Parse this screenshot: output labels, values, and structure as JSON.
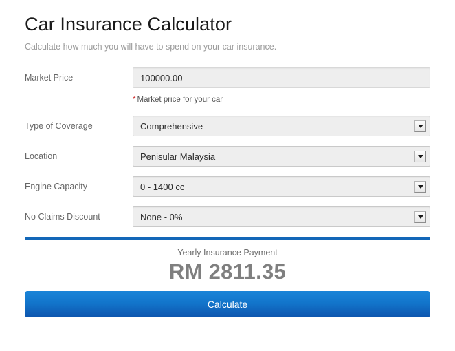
{
  "header": {
    "title": "Car Insurance Calculator",
    "subtitle": "Calculate how much you will have to spend on your car insurance."
  },
  "form": {
    "market_price": {
      "label": "Market Price",
      "value": "100000.00",
      "placeholder": "",
      "help_star": "*",
      "help_text": "Market price for your car"
    },
    "coverage": {
      "label": "Type of Coverage",
      "value": "Comprehensive"
    },
    "location": {
      "label": "Location",
      "value": "Penisular Malaysia"
    },
    "engine_capacity": {
      "label": "Engine Capacity",
      "value": "0 - 1400 cc"
    },
    "no_claims_discount": {
      "label": "No Claims Discount",
      "value": "None - 0%"
    }
  },
  "result": {
    "label": "Yearly Insurance Payment",
    "amount": "RM 2811.35"
  },
  "actions": {
    "calculate_label": "Calculate"
  },
  "colors": {
    "accent_blue": "#1367b8",
    "button_blue_top": "#1a84d8",
    "button_blue_bottom": "#0e55ae",
    "required_red": "#cc2222",
    "amount_gray": "#7f7f7f",
    "label_gray": "#666666",
    "subtitle_gray": "#9b9b9b"
  },
  "icons": {
    "dropdown": "chevron-down-icon"
  }
}
